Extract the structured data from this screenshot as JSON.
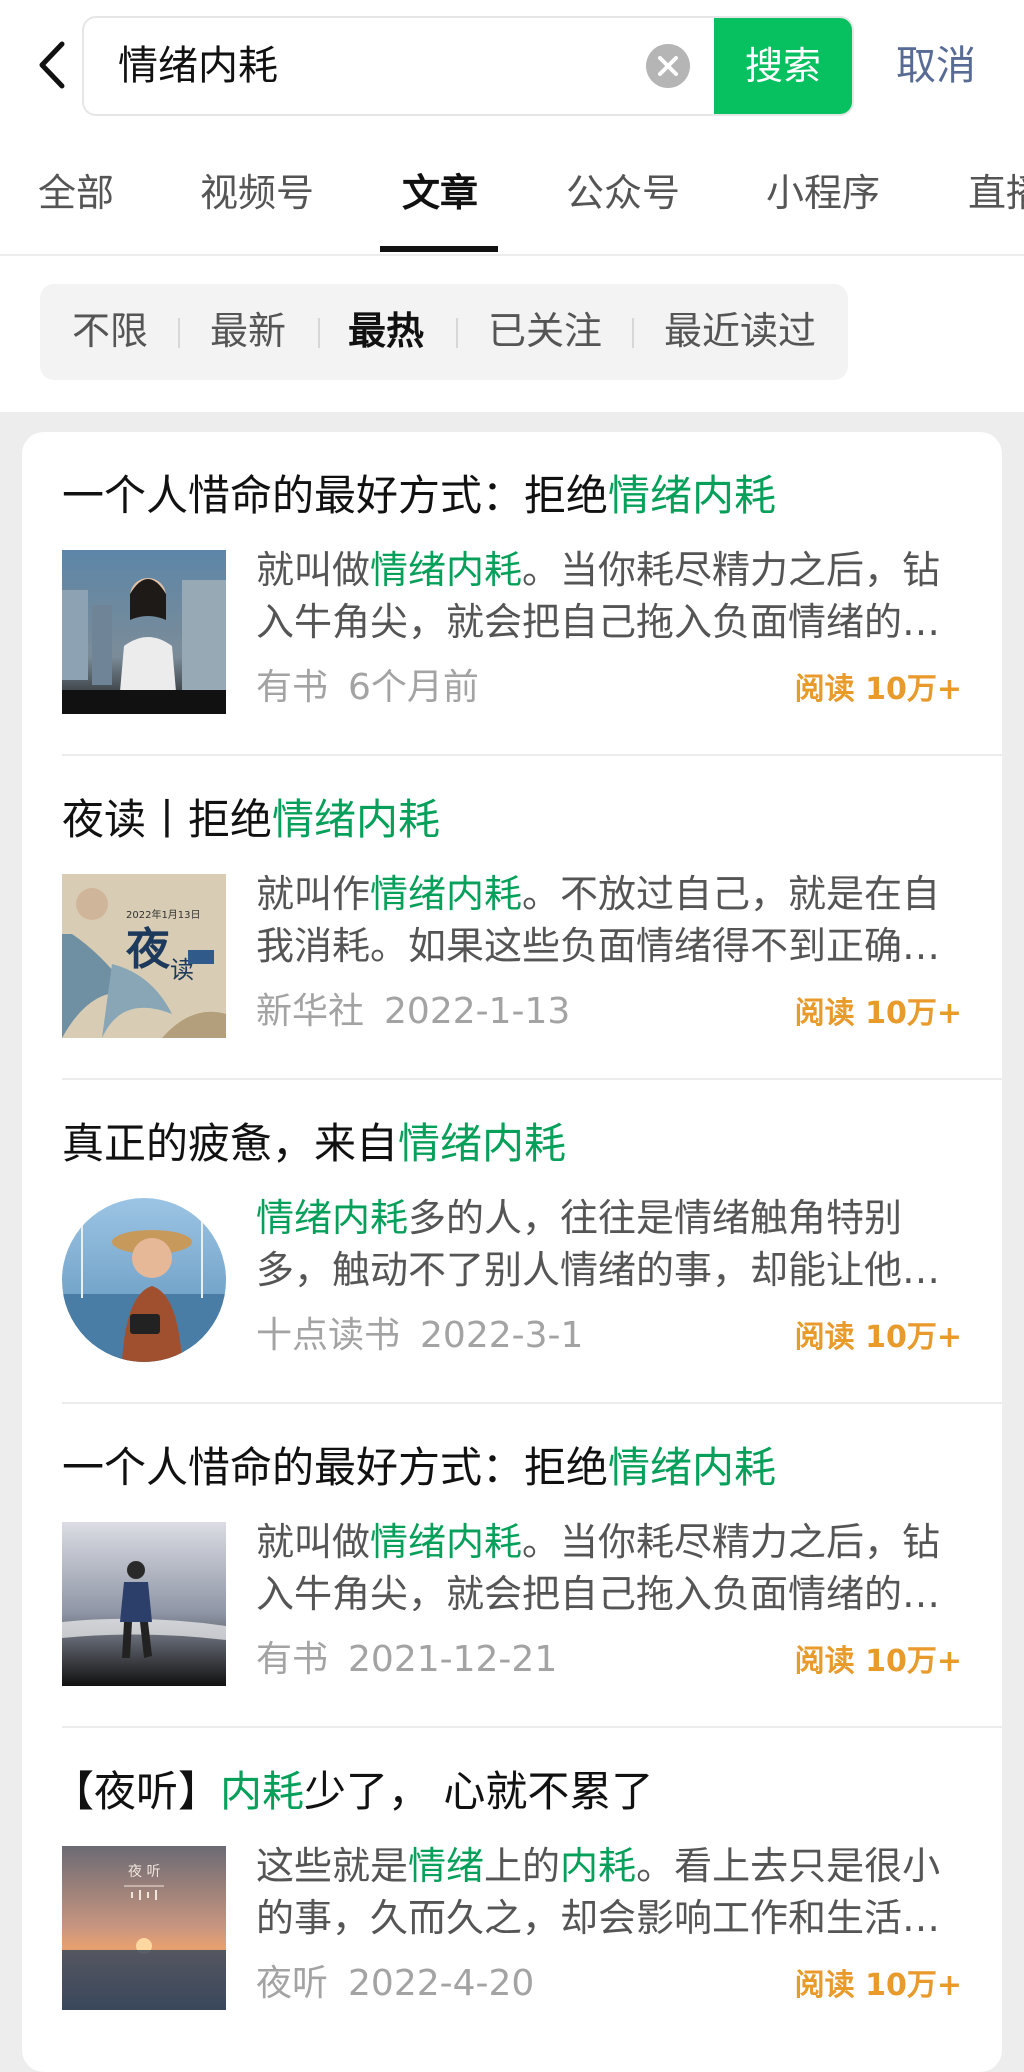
{
  "search": {
    "query": "情绪内耗",
    "button_label": "搜索",
    "cancel_label": "取消"
  },
  "tabs": [
    {
      "label": "全部"
    },
    {
      "label": "视频号"
    },
    {
      "label": "文章"
    },
    {
      "label": "公众号"
    },
    {
      "label": "小程序"
    },
    {
      "label": "直播"
    }
  ],
  "active_tab": "文章",
  "filters": [
    {
      "label": "不限"
    },
    {
      "label": "最新"
    },
    {
      "label": "最热"
    },
    {
      "label": "已关注"
    },
    {
      "label": "最近读过"
    }
  ],
  "active_filter": "最热",
  "colors": {
    "accent_green": "#07c160",
    "highlight_green": "#07a05a",
    "cancel_blue": "#576b95",
    "reads_orange": "#e89a2a"
  },
  "results": [
    {
      "title_pre": "一个人惜命的最好方式：拒绝",
      "title_hl": "情绪内耗",
      "title_post": "",
      "snippet": [
        {
          "pre": "就叫做",
          "hl": "情绪内耗",
          "post": "。当你耗尽精力之后，钻"
        },
        {
          "pre": "入牛角尖，就会把自己拖入负面情绪的…",
          "hl": "",
          "post": ""
        }
      ],
      "source": "有书",
      "date": "6个月前",
      "reads": "阅读 10万+",
      "thumb_icon": "woman-portrait-thumbnail"
    },
    {
      "title_pre": "夜读丨拒绝",
      "title_hl": "情绪内耗",
      "title_post": "",
      "snippet": [
        {
          "pre": "就叫作",
          "hl": "情绪内耗",
          "post": "。不放过自己，就是在自"
        },
        {
          "pre": "我消耗。如果这些负面情绪得不到正确…",
          "hl": "",
          "post": ""
        }
      ],
      "source": "新华社",
      "date": "2022-1-13",
      "reads": "阅读 10万+",
      "thumb_icon": "night-reading-thumbnail"
    },
    {
      "title_pre": "真正的疲惫，来自",
      "title_hl": "情绪内耗",
      "title_post": "",
      "snippet": [
        {
          "pre": "",
          "hl": "情绪内耗",
          "post": "多的人，往往是情绪触角特别"
        },
        {
          "pre": "多，触动不了别人情绪的事，却能让他…",
          "hl": "",
          "post": ""
        }
      ],
      "source": "十点读书",
      "date": "2022-3-1",
      "reads": "阅读 10万+",
      "thumb_icon": "woman-hat-circle-thumbnail"
    },
    {
      "title_pre": "一个人惜命的最好方式：拒绝",
      "title_hl": "情绪内耗",
      "title_post": "",
      "snippet": [
        {
          "pre": "就叫做",
          "hl": "情绪内耗",
          "post": "。当你耗尽精力之后，钻"
        },
        {
          "pre": "入牛角尖，就会把自己拖入负面情绪的…",
          "hl": "",
          "post": ""
        }
      ],
      "source": "有书",
      "date": "2021-12-21",
      "reads": "阅读 10万+",
      "thumb_icon": "man-on-beach-thumbnail"
    },
    {
      "title_pre": "【夜听】",
      "title_hl": "内耗",
      "title_post": "少了， 心就不累了",
      "snippet": [
        {
          "pre": "这些就是",
          "hl": "情绪",
          "post": "上的",
          "hl2": "内耗",
          "post2": "。看上去只是很小"
        },
        {
          "pre": "的事，久而久之，却会影响工作和生活…",
          "hl": "",
          "post": ""
        }
      ],
      "source": "夜听",
      "date": "2022-4-20",
      "reads": "阅读 10万+",
      "thumb_icon": "sunset-sea-thumbnail"
    }
  ]
}
